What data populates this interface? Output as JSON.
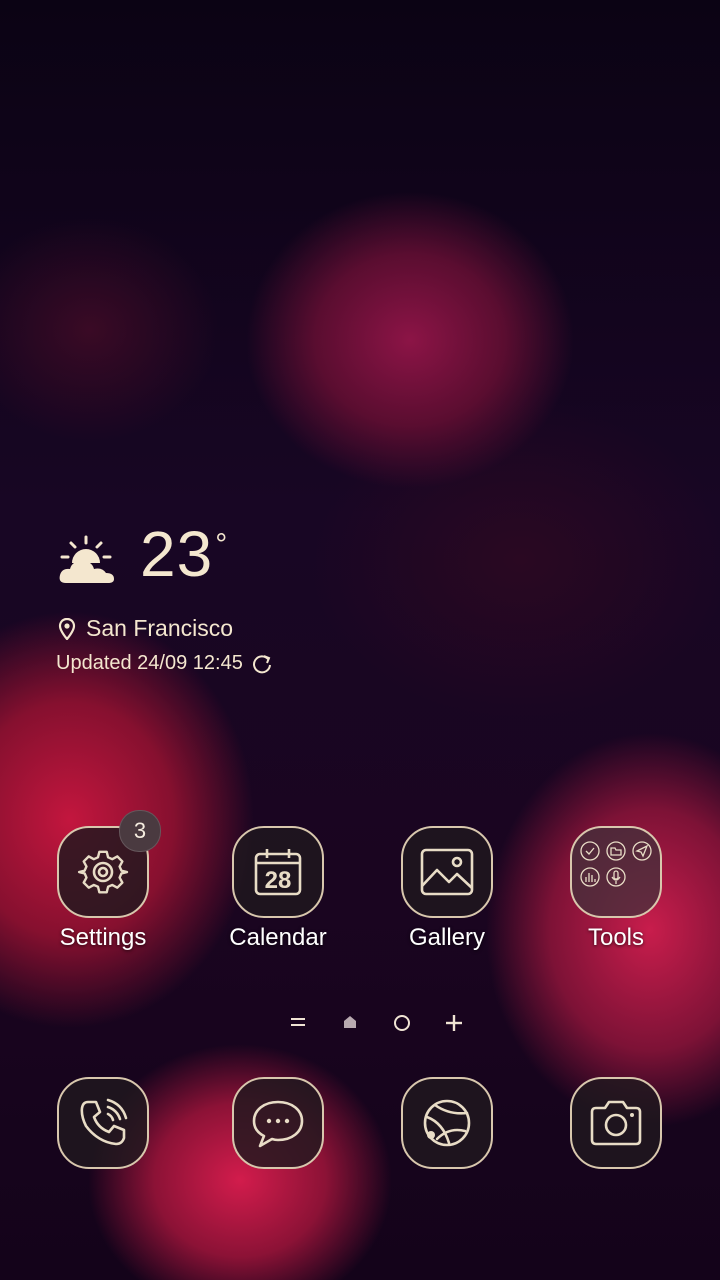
{
  "weather": {
    "condition_icon": "partly-sunny-icon",
    "temperature": "23",
    "degree_symbol": "°",
    "location": "San Francisco",
    "updated": "Updated 24/09 12:45"
  },
  "apps": [
    {
      "label": "Settings",
      "icon": "gear-icon",
      "badge": "3"
    },
    {
      "label": "Calendar",
      "icon": "calendar-icon",
      "day": "28"
    },
    {
      "label": "Gallery",
      "icon": "image-icon"
    },
    {
      "label": "Tools",
      "icon": "folder-icon"
    }
  ],
  "page_indicator": {
    "items": [
      "menu-lines-icon",
      "home-icon",
      "page-dot-icon",
      "plus-icon"
    ],
    "current": "home-icon"
  },
  "dock": [
    {
      "icon": "phone-icon"
    },
    {
      "icon": "message-icon"
    },
    {
      "icon": "browser-icon"
    },
    {
      "icon": "camera-icon"
    }
  ],
  "colors": {
    "icon_border": "#d8c7ad",
    "icon_fill": "#201820",
    "text": "#f4e7cf"
  }
}
